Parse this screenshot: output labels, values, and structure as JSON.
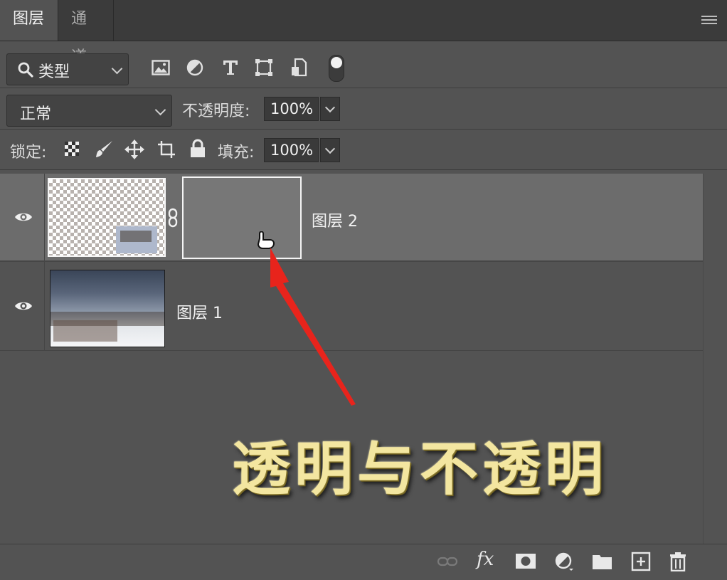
{
  "tabs": [
    {
      "label": "图层",
      "active": true
    },
    {
      "label": "通道",
      "active": false
    }
  ],
  "filter": {
    "kind_label": "类型",
    "icons": [
      "image-filter-icon",
      "adjustment-filter-icon",
      "type-filter-icon",
      "shape-filter-icon",
      "smart-object-filter-icon",
      "filter-toggle-icon"
    ]
  },
  "blend": {
    "mode": "正常",
    "opacity_label": "不透明度:",
    "opacity_value": "100%"
  },
  "lock": {
    "label": "锁定:",
    "icons": [
      "lock-transparent-pixels-icon",
      "lock-image-pixels-icon",
      "lock-position-icon",
      "lock-artboard-icon",
      "lock-all-icon"
    ],
    "fill_label": "填充:",
    "fill_value": "100%"
  },
  "layers": [
    {
      "name": "图层 2",
      "selected": true,
      "visible": true,
      "has_mask": true
    },
    {
      "name": "图层 1",
      "selected": false,
      "visible": true,
      "has_mask": false
    }
  ],
  "annotation": {
    "caption": "透明与不透明",
    "arrow_color": "#e8241c",
    "caption_color": "#f3e6a0"
  },
  "bottom_icons": [
    "link-layers-icon",
    "fx-icon",
    "add-mask-icon",
    "adjustment-layer-icon",
    "group-folder-icon",
    "new-layer-icon",
    "trash-icon"
  ],
  "fx_label": "fx"
}
